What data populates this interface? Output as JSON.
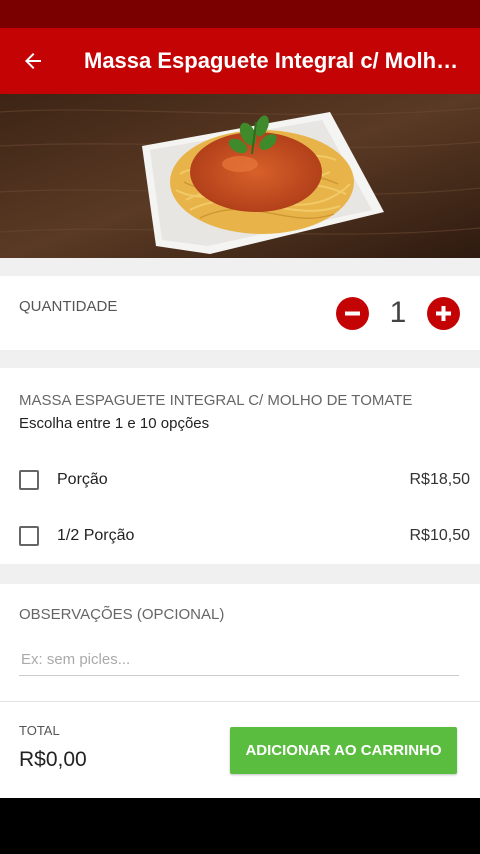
{
  "header": {
    "title": "Massa Espaguete Integral c/ Molh…"
  },
  "icons": {
    "back": "arrow-left-icon",
    "minus": "minus-icon",
    "plus": "plus-icon"
  },
  "colors": {
    "status_bar": "#7a0000",
    "app_bar": "#c40404",
    "accent_red": "#c40404",
    "add_button": "#5bbd3f"
  },
  "quantity": {
    "label": "QUANTIDADE",
    "value": "1"
  },
  "options": {
    "title": "MASSA ESPAGUETE INTEGRAL C/ MOLHO DE TOMATE",
    "subtitle": "Escolha entre 1 e 10 opções",
    "items": [
      {
        "name": "Porção",
        "price": "R$18,50",
        "checked": false
      },
      {
        "name": "1/2 Porção",
        "price": "R$10,50",
        "checked": false
      }
    ]
  },
  "observations": {
    "label": "OBSERVAÇÕES (OPCIONAL)",
    "placeholder": "Ex: sem picles...",
    "value": ""
  },
  "footer": {
    "total_label": "TOTAL",
    "total_value": "R$0,00",
    "add_button_label": "ADICIONAR AO CARRINHO"
  }
}
